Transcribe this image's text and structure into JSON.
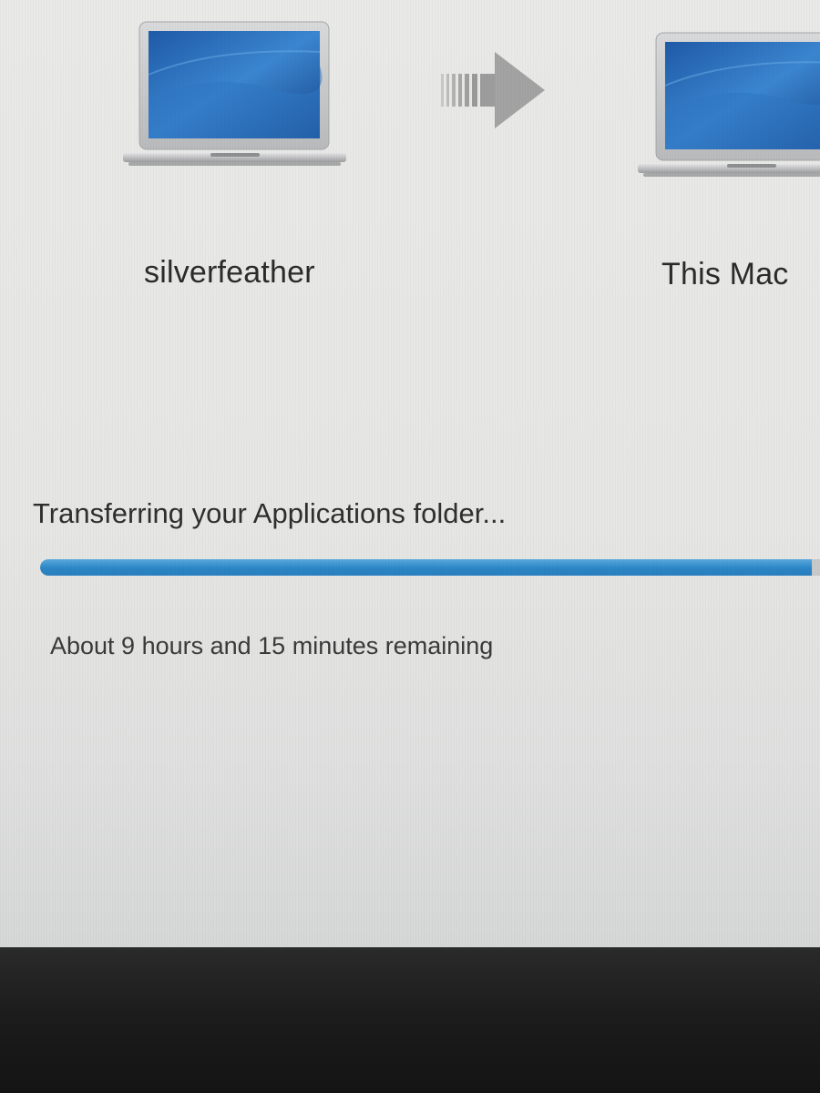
{
  "migration": {
    "source_name": "silverfeather",
    "destination_name": "This Mac",
    "status_title": "Transferring your Applications folder...",
    "time_remaining": "About 9 hours and 15 minutes remaining",
    "progress_fraction": 0.99
  },
  "icons": {
    "source": "laptop-icon",
    "destination": "laptop-icon",
    "transfer": "arrow-right-icon"
  },
  "colors": {
    "progress_fill": "#2b86c6",
    "progress_track": "#c7c9cb"
  }
}
